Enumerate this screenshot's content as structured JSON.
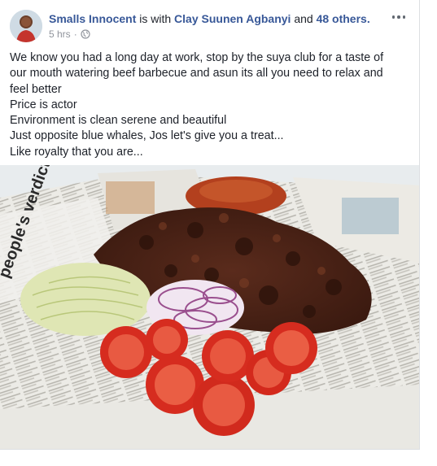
{
  "post": {
    "author": "Smalls Innocent",
    "with_text": "is with",
    "tagged_person": "Clay Suunen Agbanyi",
    "and_text": "and",
    "others_link": "48 others.",
    "time": "5 hrs",
    "separator": "·",
    "privacy_icon": "globe-icon",
    "more_icon": "more-options-icon",
    "body_lines": [
      "We know you had a long day at work, stop by the suya club for a taste of",
      "our mouth watering beef barbecue and asun its all you need to relax and",
      "feel better",
      "Price is actor",
      "Environment is clean serene and beautiful",
      "Just opposite blue whales, Jos let's give you a treat...",
      "Like royalty that you are..."
    ],
    "photo_newspaper_text": "people's verdict",
    "colors": {
      "link": "#385898",
      "meta": "#90949c",
      "text": "#1d2129"
    }
  }
}
